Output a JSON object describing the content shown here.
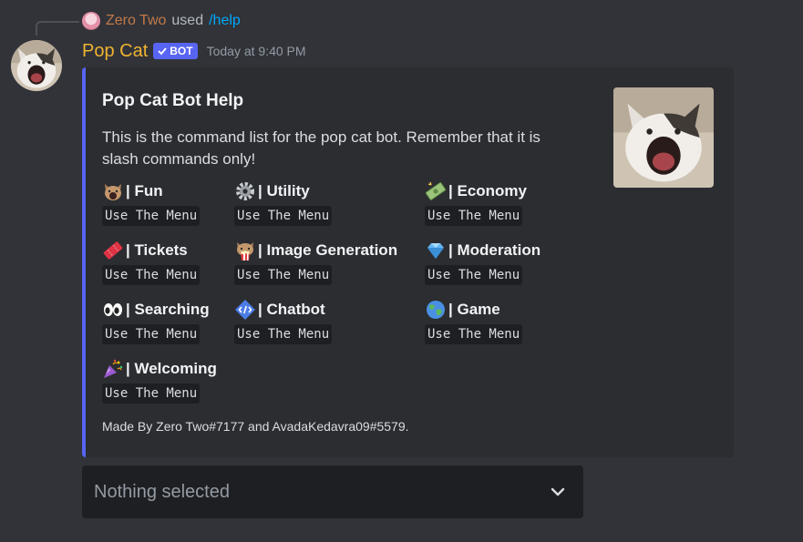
{
  "reply": {
    "username": "Zero Two",
    "used": "used",
    "command": "/help"
  },
  "message": {
    "username": "Pop Cat",
    "badge": "BOT",
    "timestamp": "Today at 9:40 PM"
  },
  "embed": {
    "title": "Pop Cat Bot Help",
    "description": "This is the command list for the pop cat bot. Remember that it is slash commands only!",
    "accent_color": "#5865f2",
    "fields": [
      {
        "icon": "cat-icon",
        "name": "| Fun",
        "value": "Use The Menu"
      },
      {
        "icon": "gear-icon",
        "name": "| Utility",
        "value": "Use The Menu"
      },
      {
        "icon": "money-icon",
        "name": "| Economy",
        "value": "Use The Menu"
      },
      {
        "icon": "ticket-icon",
        "name": "| Tickets",
        "value": "Use The Menu"
      },
      {
        "icon": "cat-popcorn-icon",
        "name": "| Image Generation",
        "value": "Use The Menu"
      },
      {
        "icon": "gem-icon",
        "name": "| Moderation",
        "value": "Use The Menu"
      },
      {
        "icon": "eyes-icon",
        "name": "| Searching",
        "value": "Use The Menu"
      },
      {
        "icon": "code-icon",
        "name": "| Chatbot",
        "value": "Use The Menu"
      },
      {
        "icon": "globe-icon",
        "name": "| Game",
        "value": "Use The Menu"
      },
      {
        "icon": "party-popper-icon",
        "name": "| Welcoming",
        "value": "Use The Menu"
      }
    ],
    "footer": "Made By Zero Two#7177 and AvadaKedavra09#5579."
  },
  "select": {
    "placeholder": "Nothing selected",
    "icon": "chevron-down-icon"
  },
  "colors": {
    "background": "#313338",
    "embed_background": "#2b2d31",
    "username": "#f0b232",
    "reply_username": "#c27a4a",
    "link": "#00a8fc",
    "bot_badge": "#5865f2"
  }
}
